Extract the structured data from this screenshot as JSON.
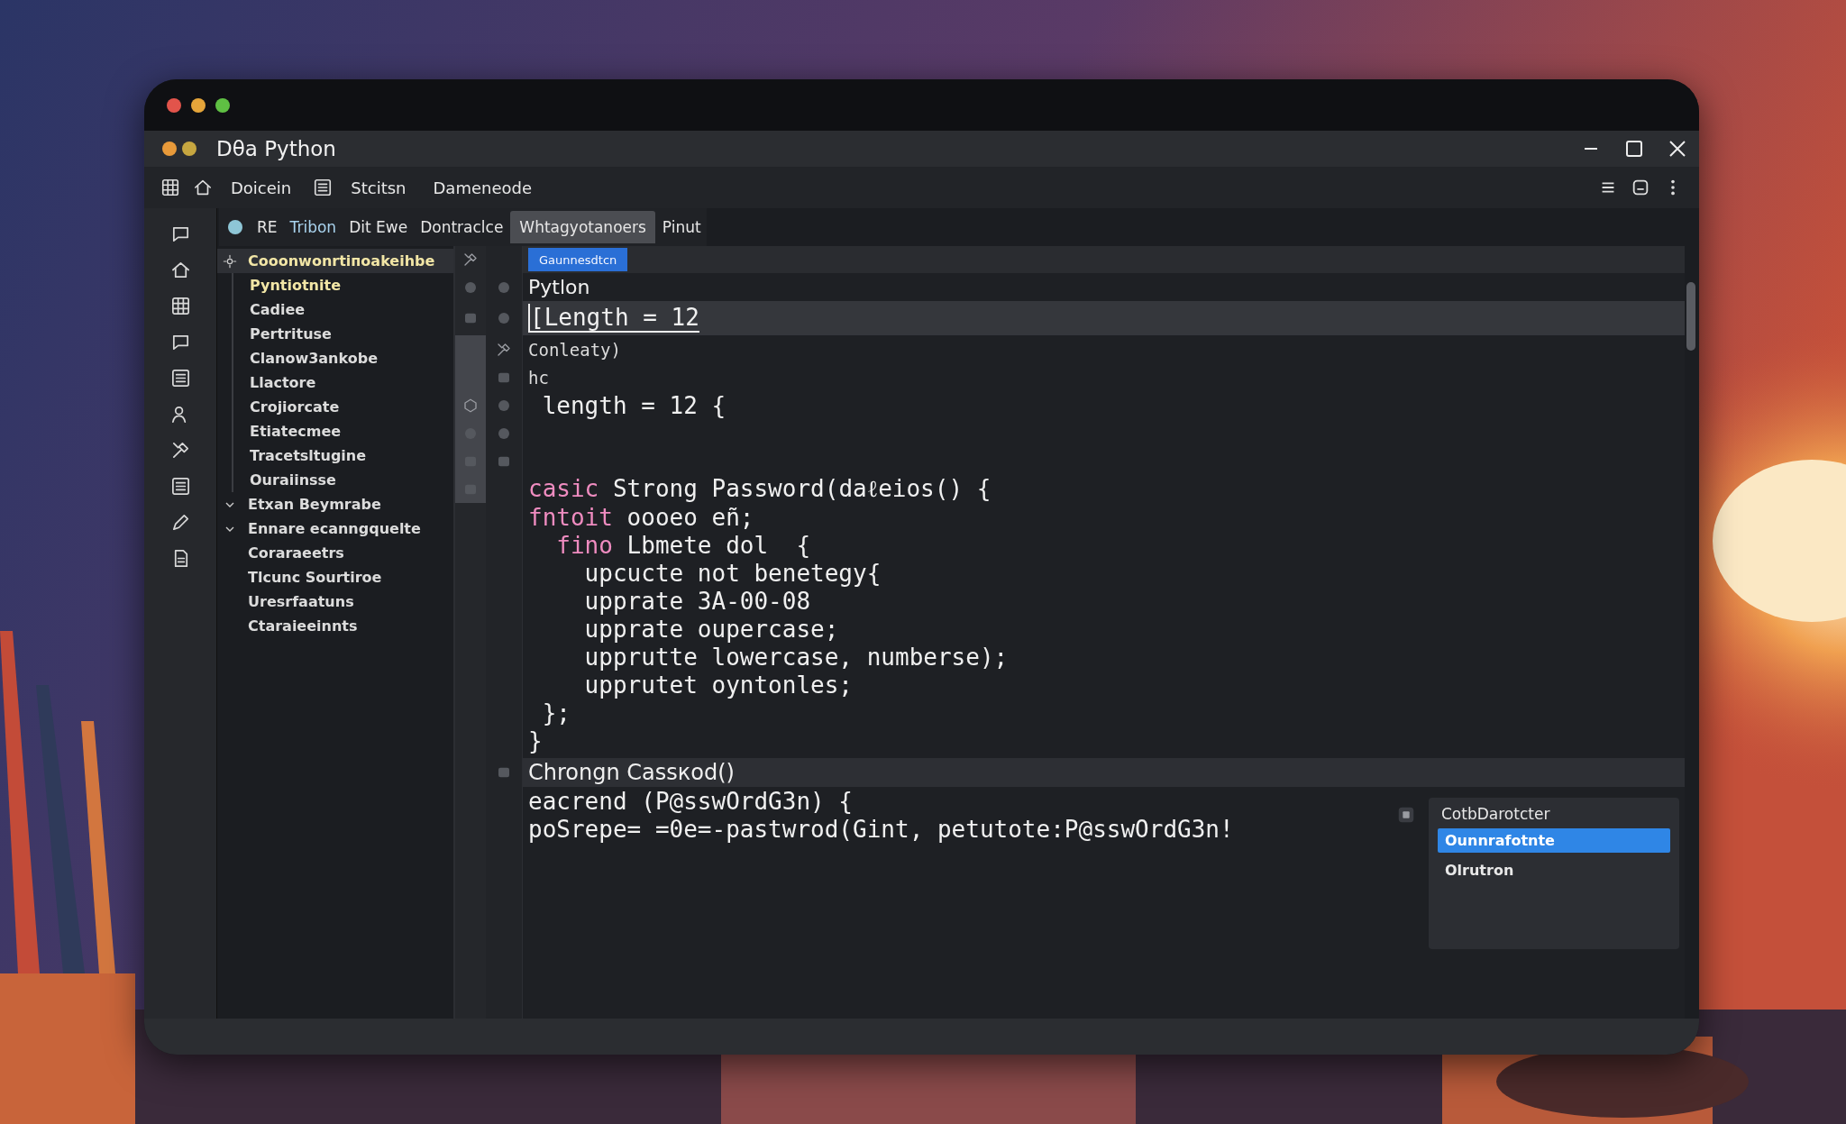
{
  "window": {
    "title": "Dθa Python"
  },
  "menu": [
    {
      "label": "Doicein"
    },
    {
      "label": "Stcitsn"
    },
    {
      "label": "Dameneode"
    }
  ],
  "tabs": [
    {
      "label": "RE",
      "kind": "plain",
      "selected": false
    },
    {
      "label": "Tribon",
      "kind": "link",
      "selected": false
    },
    {
      "label": "Dit Ewe",
      "kind": "plain",
      "selected": false
    },
    {
      "label": "Dontraclce",
      "kind": "plain",
      "selected": false
    },
    {
      "label": "Whtagyotanoers",
      "kind": "plain",
      "selected": true
    },
    {
      "label": "Pinut",
      "kind": "plain",
      "selected": false
    }
  ],
  "tree": {
    "items": [
      {
        "label": "Cooonwonrtiпoakeihbe",
        "kind": "folder",
        "selected": true,
        "highlighted": true,
        "children": [
          {
            "label": "Pyntiotnite",
            "selected": false,
            "highlighted": true
          },
          {
            "label": "Cadiee",
            "selected": false,
            "highlighted": false
          },
          {
            "label": "Pertrituse",
            "selected": false,
            "highlighted": false
          },
          {
            "label": "Clanow3ankobe",
            "selected": false,
            "highlighted": false
          },
          {
            "label": "Llactore",
            "selected": false,
            "highlighted": false
          },
          {
            "label": "Crojiorcate",
            "selected": false,
            "highlighted": false
          },
          {
            "label": "Etiatecmee",
            "selected": false,
            "highlighted": false
          },
          {
            "label": "Tracetsltugine",
            "selected": false,
            "highlighted": false
          },
          {
            "label": "Ouraiinsse",
            "selected": false,
            "highlighted": false
          }
        ]
      },
      {
        "label": "Etxan Beymrabe",
        "kind": "group",
        "selected": false,
        "highlighted": false
      },
      {
        "label": "Ennare ecanngquelte",
        "kind": "group",
        "selected": false,
        "highlighted": false
      },
      {
        "label": "Coraraeetrs",
        "kind": "file",
        "selected": false,
        "highlighted": false
      },
      {
        "label": "Tlcunc Sourtiroe",
        "kind": "file",
        "selected": false,
        "highlighted": false
      },
      {
        "label": "Uresrfaatuns",
        "kind": "file",
        "selected": false,
        "highlighted": false
      },
      {
        "label": "Ctaraieeinnts",
        "kind": "file",
        "selected": false,
        "highlighted": false
      }
    ]
  },
  "editor": {
    "subtab": {
      "label": "Gaunnesdtcn",
      "selected": true
    },
    "lines": [
      {
        "kind": "header",
        "text": "Pytlon",
        "selected": false
      },
      {
        "kind": "code",
        "text": "[Length = 12",
        "selected": true
      },
      {
        "kind": "small",
        "text": "Conleaty)",
        "selected": false
      },
      {
        "kind": "small",
        "text": "hc",
        "selected": false
      },
      {
        "kind": "code",
        "text": " length = 12 {",
        "selected": false
      },
      {
        "kind": "blank"
      },
      {
        "kind": "blank"
      },
      {
        "kind": "code",
        "keyword": "casic",
        "text": " Strong Password(daℓeios() {",
        "selected": false
      },
      {
        "kind": "code",
        "keyword": "fntoit",
        "text": " oooeo eñ;",
        "selected": false
      },
      {
        "kind": "code",
        "keyword": "  fino",
        "text": " Lbmete dol  {",
        "selected": false
      },
      {
        "kind": "code",
        "text": "    upcucte not benetegy{",
        "selected": false
      },
      {
        "kind": "code",
        "text": "    upprate 3A-00-08",
        "selected": false
      },
      {
        "kind": "code",
        "text": "    upprate oupercase;",
        "selected": false
      },
      {
        "kind": "code",
        "text": "    upprutte lowercase, numberse);",
        "selected": false
      },
      {
        "kind": "code",
        "text": "    upprutet oyntonles;",
        "selected": false
      },
      {
        "kind": "code",
        "text": " };",
        "selected": false
      },
      {
        "kind": "code",
        "text": "}",
        "selected": false
      }
    ],
    "section": {
      "title": "Chrongn Cassкod()"
    },
    "lines_2": [
      {
        "text": "eacrend (P@sswOrdG3n) {",
        "selected": false
      },
      {
        "text": "poSrepe= =0e=-pastwrod(Gint, petutote:P@sswOrdG3n!",
        "selected": false
      }
    ],
    "suggestions": {
      "title": "CotbDarotcter",
      "items": [
        {
          "label": "Ounnrafotnte",
          "selected": true
        },
        {
          "label": "Olrutron",
          "selected": false
        }
      ]
    }
  }
}
